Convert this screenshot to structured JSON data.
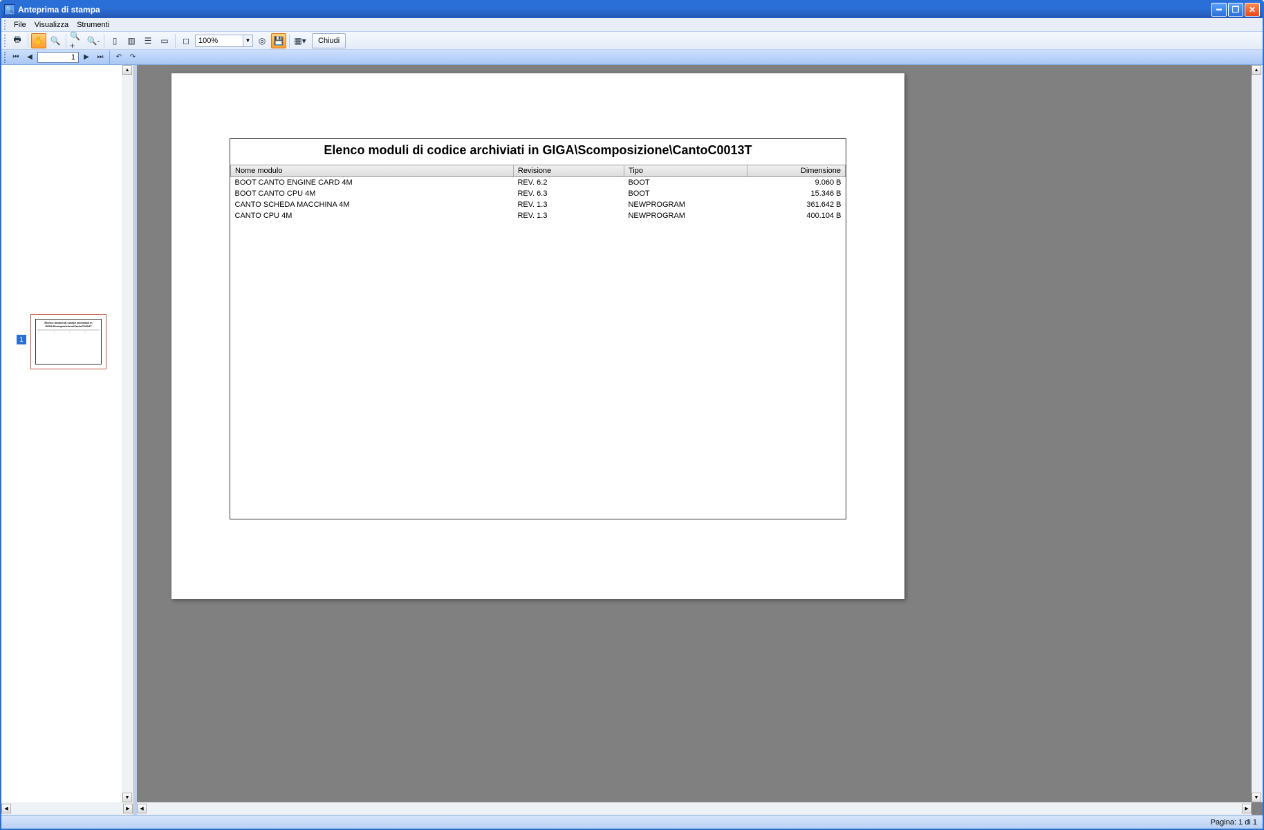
{
  "window": {
    "title": "Anteprima di stampa"
  },
  "menubar": {
    "file": "File",
    "view": "Visualizza",
    "tools": "Strumenti"
  },
  "toolbar": {
    "zoom_value": "100%",
    "close_label": "Chiudi"
  },
  "nav": {
    "page_input": "1"
  },
  "thumbs": {
    "label_1": "1"
  },
  "report": {
    "title": "Elenco moduli di codice archiviati in GIGA\\Scomposizione\\CantoC0013T",
    "headers": {
      "name": "Nome modulo",
      "rev": "Revisione",
      "type": "Tipo",
      "size": "Dimensione"
    },
    "rows": [
      {
        "name": "BOOT CANTO ENGINE CARD 4M",
        "rev": "REV. 6.2",
        "type": "BOOT",
        "size": "9.060 B"
      },
      {
        "name": "BOOT CANTO CPU 4M",
        "rev": "REV. 6.3",
        "type": "BOOT",
        "size": "15.346 B"
      },
      {
        "name": "CANTO SCHEDA MACCHINA 4M",
        "rev": "REV. 1.3",
        "type": "NEWPROGRAM",
        "size": "361.642 B"
      },
      {
        "name": "CANTO CPU 4M",
        "rev": "REV. 1.3",
        "type": "NEWPROGRAM",
        "size": "400.104 B"
      }
    ]
  },
  "status": {
    "page_info": "Pagina: 1 di 1"
  }
}
